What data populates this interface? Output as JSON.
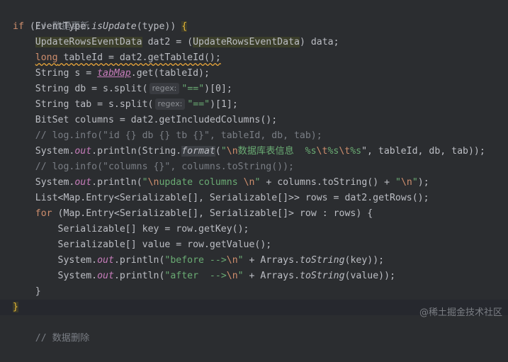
{
  "code": {
    "comment_update": "// 数据更新",
    "kw_if": "if",
    "cond": " (EventType.",
    "isUpdate": "isUpdate",
    "cond_end": "(type)) ",
    "brace_open": "{",
    "cast_type1": "UpdateRowsEventData",
    "decl_rest1": " dat2 = (",
    "cast_type2": "UpdateRowsEventData",
    "decl_end1": ") data;",
    "kw_long": "long",
    "table_id_rest": " tableId = dat2.getTableId();",
    "string_s": "String s = ",
    "tabmap": "tabMap",
    "string_s_end": ".get(tableId);",
    "db_decl": "String db = s.split(",
    "regex_hint": "regex:",
    "eq_str": "\"==\"",
    "db_end": ")[0];",
    "tab_decl": "String tab = s.split(",
    "tab_end": ")[1];",
    "bitset": "BitSet columns = dat2.getIncludedColumns();",
    "comment_log1": "// log.info(\"id {} db {} tb {}\", tableId, db, tab);",
    "system": "System.",
    "out": "out",
    "println_string": ".println(String.",
    "format": "format",
    "paren": "(",
    "str_q": "\"",
    "esc_n": "\\n",
    "fmt_text": "数据库表信息  %s",
    "esc_t": "\\t",
    "fmt_s": "%s",
    "fmt_tail": "\", tableId, db, tab));",
    "comment_log2": "// log.info(\"columns {}\", columns.toString());",
    "println_open": ".println(",
    "update_cols": "update columns ",
    "cols_mid": " + columns.toString() + ",
    "end_paren": ");",
    "list_decl": "List<Map.Entry<Serializable[], Serializable[]>> rows = dat2.getRows();",
    "kw_for": "for",
    "for_rest": " (Map.Entry<Serializable[], Serializable[]> row : rows) {",
    "key_decl": "Serializable[] key = row.getKey();",
    "value_decl": "Serializable[] value = row.getValue();",
    "before_str": "before -->",
    "arrays_call": " + Arrays.",
    "to_string": "toString",
    "key_arg": "(key));",
    "after_str": "after  -->",
    "value_arg": "(value));",
    "inner_close": "}",
    "outer_close": "}",
    "comment_delete": "// 数据删除"
  },
  "watermark": "@稀土掘金技术社区",
  "colors": {
    "background": "#2b2d30",
    "keyword": "#cf8e6d",
    "string": "#6aab73",
    "comment": "#7a7e85",
    "field": "#c77dbb",
    "text": "#bcbec4",
    "brace_match": "#e8ba36"
  }
}
